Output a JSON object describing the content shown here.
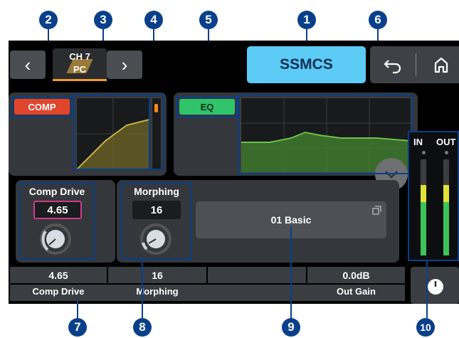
{
  "callouts": [
    "1",
    "2",
    "3",
    "4",
    "5",
    "6",
    "7",
    "8",
    "9",
    "10"
  ],
  "header": {
    "channel_line1": "CH 7",
    "channel_line2": "PC",
    "prev_glyph": "‹",
    "next_glyph": "›",
    "preset_name": "SSMCS",
    "back_icon": "undo-icon",
    "home_icon": "home-icon"
  },
  "comp": {
    "label": "COMP",
    "color": "#e0462e"
  },
  "eq": {
    "label": "EQ",
    "color": "#2fc46a"
  },
  "comp_drive": {
    "label": "Comp Drive",
    "value": "4.65"
  },
  "morphing": {
    "label": "Morphing",
    "value": "16"
  },
  "preset_select": {
    "value": "01 Basic"
  },
  "meter": {
    "in_label": "IN",
    "out_label": "OUT"
  },
  "bottom_strip": [
    {
      "value": "4.65",
      "label": "Comp Drive"
    },
    {
      "value": "16",
      "label": "Morphing"
    },
    {
      "value": "",
      "label": ""
    },
    {
      "value": "0.0dB",
      "label": "Out Gain"
    }
  ],
  "colors": {
    "accent": "#5ccbf5",
    "callout": "#0a3f8a",
    "gain_reduction": "#ff8a1c"
  }
}
